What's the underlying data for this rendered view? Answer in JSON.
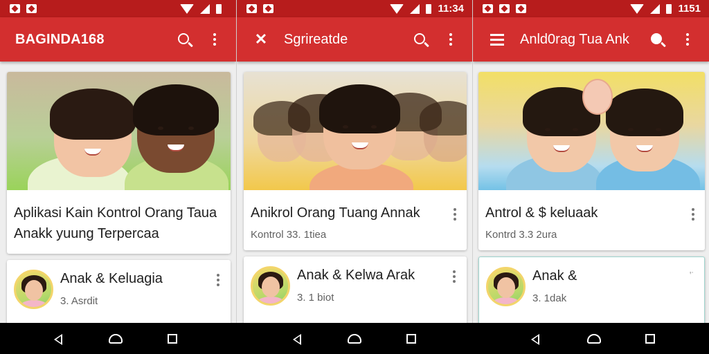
{
  "phones": [
    {
      "status": {
        "time": ""
      },
      "appbar": {
        "title": "BAGINDA168"
      },
      "feature_card": {
        "title": "Aplikasi Kain Kontrol Orang Taua Anakk yuung Terpercaa",
        "subtitle": ""
      },
      "list_card": {
        "title": "Anak & Keluagia",
        "subtitle": "3. Asrdit"
      }
    },
    {
      "status": {
        "time": "11:34"
      },
      "appbar": {
        "title": "Sgrireatde"
      },
      "feature_card": {
        "title": "Anikrol Orang Tuang Annak",
        "subtitle": "Kontrol 33. 1tiea"
      },
      "list_card": {
        "title": "Anak & Kelwa Arak",
        "subtitle": "3. 1 biot"
      }
    },
    {
      "status": {
        "time": "1151"
      },
      "appbar": {
        "title": "Anld0rag Tua Ank"
      },
      "feature_card": {
        "title": "Antrol & $ keluaak",
        "subtitle": "Kontrd 3.3 2ura"
      },
      "list_card": {
        "title": "Anak &",
        "subtitle": "3. 1dak",
        "side_mark": "ꞌʿ"
      }
    }
  ],
  "colors": {
    "statusbar": "#b71c1c",
    "appbar": "#d32f2f",
    "background": "#eeeeee"
  },
  "icons": [
    "search-icon",
    "more-vert-icon",
    "tools-icon",
    "menu-icon",
    "back-icon",
    "home-icon",
    "recents-icon"
  ]
}
